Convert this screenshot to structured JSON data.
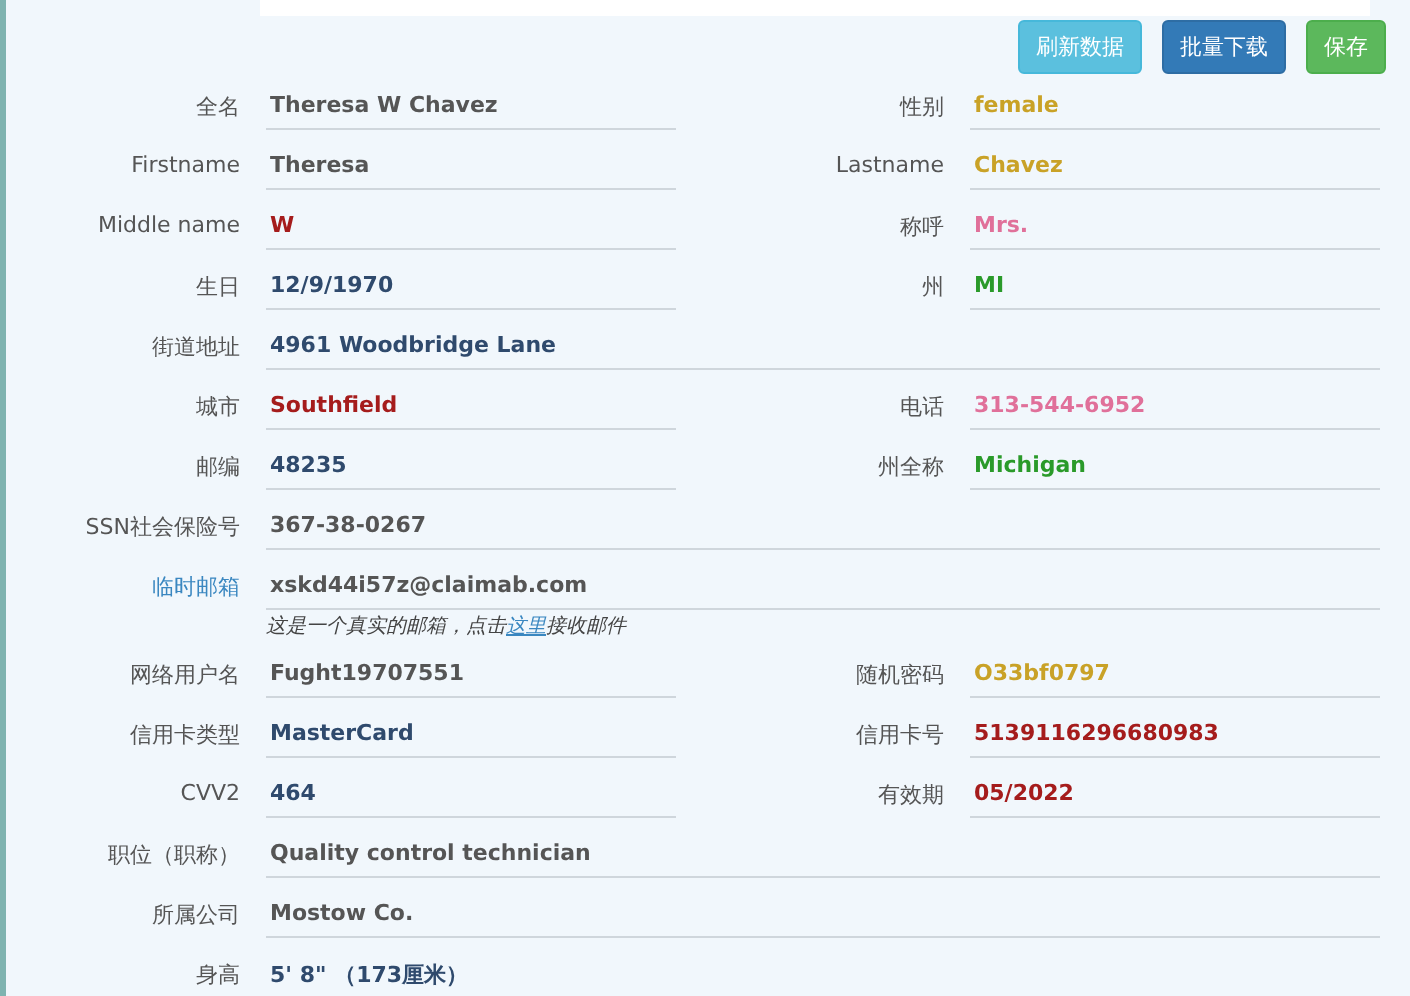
{
  "buttons": [
    {
      "label": "刷新数据",
      "kind": "info"
    },
    {
      "label": "批量下载",
      "kind": "primary"
    },
    {
      "label": "保存",
      "kind": "success"
    }
  ],
  "rows": [
    {
      "fields": [
        {
          "label": "全名",
          "value": "Theresa W Chavez",
          "color": "#555555"
        },
        {
          "label": "性别",
          "value": "female",
          "color": "#c9a227"
        }
      ]
    },
    {
      "fields": [
        {
          "label": "Firstname",
          "value": "Theresa",
          "color": "#555555"
        },
        {
          "label": "Lastname",
          "value": "Chavez",
          "color": "#c9a227"
        }
      ]
    },
    {
      "fields": [
        {
          "label": "Middle name",
          "value": "W",
          "color": "#a51c1c"
        },
        {
          "label": "称呼",
          "value": "Mrs.",
          "color": "#e0709a"
        }
      ]
    },
    {
      "fields": [
        {
          "label": "生日",
          "value": "12/9/1970",
          "color": "#2f4a6d"
        },
        {
          "label": "州",
          "value": "MI",
          "color": "#2a9a2a"
        }
      ]
    },
    {
      "fields": [
        {
          "label": "街道地址",
          "value": "4961 Woodbridge Lane",
          "color": "#2f4a6d"
        }
      ]
    },
    {
      "fields": [
        {
          "label": "城市",
          "value": "Southfield",
          "color": "#a51c1c"
        },
        {
          "label": "电话",
          "value": "313-544-6952",
          "color": "#e0709a"
        }
      ]
    },
    {
      "fields": [
        {
          "label": "邮编",
          "value": "48235",
          "color": "#2f4a6d"
        },
        {
          "label": "州全称",
          "value": "Michigan",
          "color": "#2a9a2a"
        }
      ]
    },
    {
      "fields": [
        {
          "label": "SSN社会保险号",
          "value": "367-38-0267",
          "color": "#555555"
        }
      ]
    },
    {
      "fields": [
        {
          "label": "临时邮箱",
          "value": "xskd44i57z@claimab.com",
          "color": "#555555",
          "kind": "email",
          "hint_before": "这是一个真实的邮箱，点击",
          "hint_link": "这里",
          "hint_after": "接收邮件"
        }
      ]
    },
    {
      "fields": [
        {
          "label": "网络用户名",
          "value": "Fught19707551",
          "color": "#555555"
        },
        {
          "label": "随机密码",
          "value": "O33bf0797",
          "color": "#c9a227"
        }
      ]
    },
    {
      "fields": [
        {
          "label": "信用卡类型",
          "value": "MasterCard",
          "color": "#2f4a6d"
        },
        {
          "label": "信用卡号",
          "value": "5139116296680983",
          "color": "#a51c1c"
        }
      ]
    },
    {
      "fields": [
        {
          "label": "CVV2",
          "value": "464",
          "color": "#2f4a6d"
        },
        {
          "label": "有效期",
          "value": "05/2022",
          "color": "#a51c1c"
        }
      ]
    },
    {
      "fields": [
        {
          "label": "职位（职称）",
          "value": "Quality control technician",
          "color": "#555555"
        }
      ]
    },
    {
      "fields": [
        {
          "label": "所属公司",
          "value": "Mostow Co.",
          "color": "#555555"
        }
      ]
    },
    {
      "fields": [
        {
          "label": "身高",
          "value": "5' 8\" （173厘米）",
          "color": "#2f4a6d"
        }
      ]
    }
  ]
}
